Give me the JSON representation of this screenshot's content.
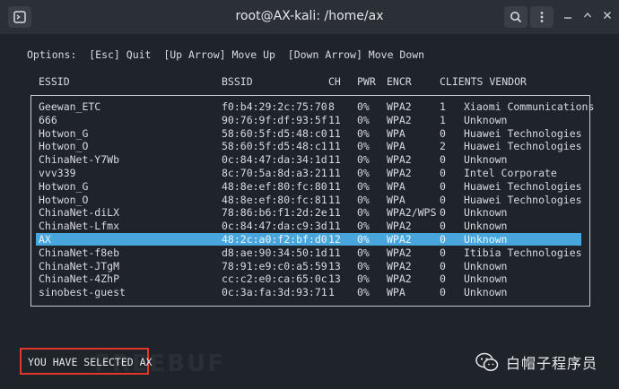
{
  "window": {
    "title": "root@AX-kali: /home/ax"
  },
  "icons": {
    "new_tab": "terminal-icon",
    "search": "search-icon",
    "menu": "kebab-menu-icon",
    "minimize": "minimize-icon",
    "maximize": "maximize-icon",
    "close": "close-icon",
    "wechat": "wechat-logo-icon"
  },
  "terminal": {
    "options_line": "Options:  [Esc] Quit  [Up Arrow] Move Up  [Down Arrow] Move Down",
    "headers": {
      "essid": "ESSID",
      "bssid": "BSSID",
      "ch": "CH",
      "pwr": "PWR",
      "encr": "ENCR",
      "clients_vendor": "CLIENTS VENDOR"
    },
    "rows": [
      {
        "essid": "Geewan_ETC",
        "bssid": "f0:b4:29:2c:75:70",
        "ch": "8",
        "pwr": "0%",
        "encr": "WPA2",
        "clients": "1",
        "vendor": "Xiaomi Communications",
        "selected": false
      },
      {
        "essid": "666",
        "bssid": "90:76:9f:df:93:5f",
        "ch": "11",
        "pwr": "0%",
        "encr": "WPA2",
        "clients": "1",
        "vendor": "Unknown",
        "selected": false
      },
      {
        "essid": "Hotwon_G",
        "bssid": "58:60:5f:d5:48:c0",
        "ch": "11",
        "pwr": "0%",
        "encr": "WPA",
        "clients": "0",
        "vendor": "Huawei Technologies",
        "selected": false
      },
      {
        "essid": "Hotwon_O",
        "bssid": "58:60:5f:d5:48:c1",
        "ch": "11",
        "pwr": "0%",
        "encr": "WPA",
        "clients": "2",
        "vendor": "Huawei Technologies",
        "selected": false
      },
      {
        "essid": "ChinaNet-Y7Wb",
        "bssid": "0c:84:47:da:34:1d",
        "ch": "11",
        "pwr": "0%",
        "encr": "WPA2",
        "clients": "0",
        "vendor": "Unknown",
        "selected": false
      },
      {
        "essid": "vvv339",
        "bssid": "8c:70:5a:8d:a3:21",
        "ch": "11",
        "pwr": "0%",
        "encr": "WPA2",
        "clients": "0",
        "vendor": "Intel Corporate",
        "selected": false
      },
      {
        "essid": "Hotwon_G",
        "bssid": "48:8e:ef:80:fc:80",
        "ch": "11",
        "pwr": "0%",
        "encr": "WPA",
        "clients": "0",
        "vendor": "Huawei Technologies",
        "selected": false
      },
      {
        "essid": "Hotwon_O",
        "bssid": "48:8e:ef:80:fc:81",
        "ch": "11",
        "pwr": "0%",
        "encr": "WPA",
        "clients": "0",
        "vendor": "Huawei Technologies",
        "selected": false
      },
      {
        "essid": "ChinaNet-diLX",
        "bssid": "78:86:b6:f1:2d:2e",
        "ch": "11",
        "pwr": "0%",
        "encr": "WPA2/WPS",
        "clients": "0",
        "vendor": "Unknown",
        "selected": false
      },
      {
        "essid": "ChinaNet-Lfmx",
        "bssid": "0c:84:47:da:c9:3d",
        "ch": "11",
        "pwr": "0%",
        "encr": "WPA2",
        "clients": "0",
        "vendor": "Unknown",
        "selected": false
      },
      {
        "essid": "AX",
        "bssid": "48:2c:a0:f2:bf:d0",
        "ch": "12",
        "pwr": "0%",
        "encr": "WPA2",
        "clients": "0",
        "vendor": "Unknown",
        "selected": true
      },
      {
        "essid": "ChinaNet-f8eb",
        "bssid": "d8:ae:90:34:50:1d",
        "ch": "11",
        "pwr": "0%",
        "encr": "WPA2",
        "clients": "0",
        "vendor": "Itibia Technologies",
        "selected": false
      },
      {
        "essid": "ChinaNet-JTgM",
        "bssid": "78:91:e9:c0:a5:59",
        "ch": "13",
        "pwr": "0%",
        "encr": "WPA2",
        "clients": "0",
        "vendor": "Unknown",
        "selected": false
      },
      {
        "essid": "ChinaNet-4ZhP",
        "bssid": "cc:c2:e0:ca:65:0c",
        "ch": "13",
        "pwr": "0%",
        "encr": "WPA2",
        "clients": "0",
        "vendor": "Unknown",
        "selected": false
      },
      {
        "essid": "sinobest-guest",
        "bssid": "0c:3a:fa:3d:93:71",
        "ch": "1",
        "pwr": "0%",
        "encr": "WPA",
        "clients": "0",
        "vendor": "Unknown",
        "selected": false
      }
    ],
    "status_text": "YOU HAVE SELECTED AX"
  },
  "watermark": {
    "text": "FREEBUF",
    "account_name": "白帽子程序员"
  },
  "colors": {
    "selection": "#49a6dc",
    "status_border": "#e2382c",
    "terminal_bg": "#1f232a"
  }
}
